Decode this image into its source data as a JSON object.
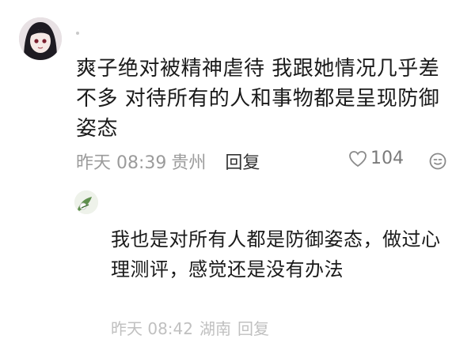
{
  "comment": {
    "text": "爽子绝对被精神虐待 我跟她情况几乎差不多 对待所有的人和事物都是呈现防御姿态",
    "time": "昨天 08:39",
    "location": "贵州",
    "reply_label": "回复",
    "like_count": "104"
  },
  "reply": {
    "text": "我也是对所有人都是防御姿态，做过心理测评，感觉还是没有办法",
    "partial_time": "昨天 08:42",
    "partial_location": "湖南",
    "partial_reply_label": "回复"
  },
  "icons": {
    "avatar_main": "anime-girl-avatar",
    "avatar_reply": "green-avatar",
    "like": "heart-outline-icon",
    "emoji": "emoji-icon"
  }
}
